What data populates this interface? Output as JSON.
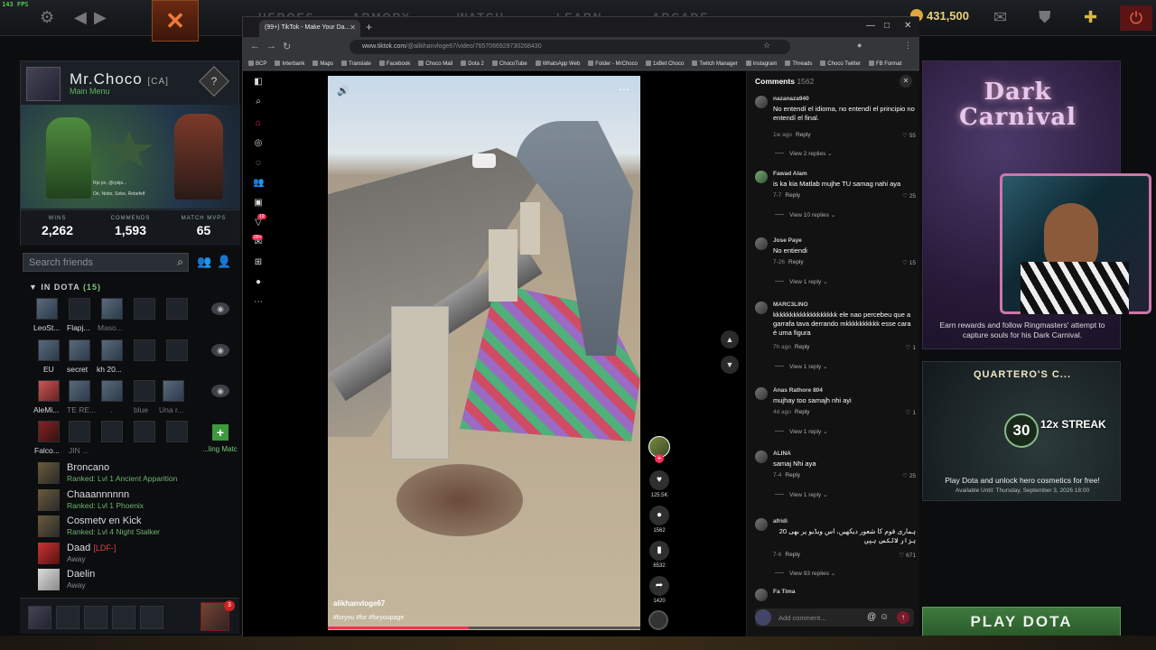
{
  "fps": "143 FPS",
  "dota": {
    "gold": "431,500",
    "nav_items": [
      "HEROES",
      "ARMORY",
      "WATCH",
      "LEARN",
      "ARCADE"
    ],
    "profile": {
      "name": "Mr.Choco",
      "tag": "[CA]",
      "status": "Main Menu",
      "music_title": "Rpi po, @rpiipi...",
      "music_sub": "Oe, Nobe, Sobe, Rebefelf",
      "stats": [
        {
          "label": "WINS",
          "value": "2,262"
        },
        {
          "label": "COMMENDS",
          "value": "1,593"
        },
        {
          "label": "MATCH MVPS",
          "value": "65"
        }
      ]
    },
    "friends_search_placeholder": "Search friends",
    "in_dota_label": "IN DOTA",
    "in_dota_count": "(15)",
    "party_rows": [
      {
        "names": [
          "LeoSt...",
          "Flapj...",
          "Maso..."
        ]
      },
      {
        "names": [
          "EU",
          "secret",
          "kh 20..."
        ]
      },
      {
        "names": [
          "AleMi...",
          "TE RE...",
          ".",
          "blue",
          "Una r..."
        ]
      },
      {
        "names": [
          "Falco...",
          "JIN ..."
        ]
      }
    ],
    "finding_match_label": "...ling Matc",
    "friends": [
      {
        "name": "Broncano",
        "tag": "",
        "rank": "Ranked: Lvl 1 Ancient Apparition",
        "away": false
      },
      {
        "name": "Chaaannnnnn",
        "tag": "",
        "rank": "Ranked: Lvl 1 Phoenix",
        "away": false
      },
      {
        "name": "Cosmetv en Kick",
        "tag": "",
        "rank": "Ranked: Lvl 4 Night Stalker",
        "away": false
      },
      {
        "name": "Daad",
        "tag": "[LDF-]",
        "rank": "Away",
        "away": true
      },
      {
        "name": "Daelin",
        "tag": "",
        "rank": "Away",
        "away": true
      }
    ],
    "notif_count": "3",
    "dark_carnival": {
      "title": "Dark Carnival",
      "desc": "Earn rewards and follow Ringmasters' attempt to capture souls for his Dark Carnival."
    },
    "quartero": {
      "title": "QUARTERO'S C...",
      "number": "30",
      "streak": "12x STREAK",
      "text": "Play Dota and unlock hero cosmetics for free!",
      "until": "Available Until:  Thursday, September 3, 2026 18:00"
    },
    "play_label": "PLAY DOTA"
  },
  "browser": {
    "tab_title": "(99+) TikTok - Make Your Da...",
    "url_host": "www.tiktok.com",
    "url_path": "/@alikhanvloge67/video/7657066929730268430",
    "bookmarks": [
      "BCP",
      "Interbank",
      "Maps",
      "Translate",
      "Facebook",
      "Choco Mail",
      "Dota 2",
      "ChocoTube",
      "WhatsApp Web",
      "Folder - MrChoco",
      "1xBet Choco",
      "Twitch Manager",
      "Instagram",
      "Threads",
      "Choco Twitter",
      "FB Format"
    ]
  },
  "tiktok": {
    "side_badges": [
      "19",
      "99+"
    ],
    "video_user": "alikhanvloge67",
    "video_tags": "#foryou #for #foryoupage",
    "progress": 0.45,
    "likes": "125.5K",
    "comments_count": "1562",
    "saves": "6532",
    "shares": "1420",
    "comments_title": "Comments",
    "comments": [
      {
        "user": "nazanaza940",
        "text": "No entendí el idioma, no entendí el principio no entendí el final.",
        "time": "1w ago",
        "likes": "55",
        "replies": "View 2 replies"
      },
      {
        "user": "Fawad Alam",
        "text": "is ka kia Matlab mujhe TU samag nahi aya",
        "time": "7-7",
        "likes": "25",
        "replies": "View 10 replies"
      },
      {
        "user": "Jose Paye",
        "text": "No entiendi",
        "time": "7-26",
        "likes": "15",
        "replies": "View 1 reply"
      },
      {
        "user": "MARC3LINO",
        "text": "kkkkkkkkkkkkkkkkkkk ele nao percebeu que a garrafa tava derrando mkkkkkkkkkk esse cara é uma figura",
        "time": "7h ago",
        "likes": "1",
        "replies": "View 1 reply"
      },
      {
        "user": "Anas Rathore 804",
        "text": "mujhay too samajh nhi ayi",
        "time": "4d ago",
        "likes": "1",
        "replies": "View 1 reply"
      },
      {
        "user": "ALINA",
        "text": "samaj Nhi aya",
        "time": "7-4",
        "likes": "25",
        "replies": "View 1 reply"
      },
      {
        "user": "afridi",
        "text": "ہماری قوم کا شعور دیکھیں، اس ویڈیو پر بھی 20 ہزار لائکس ہیں",
        "time": "7-6",
        "likes": "671",
        "replies": "View 93 replies"
      },
      {
        "user": "Fa Tima",
        "text": "",
        "time": "",
        "likes": "",
        "replies": ""
      }
    ],
    "reply_label": "Reply",
    "add_comment_placeholder": "Add comment..."
  }
}
